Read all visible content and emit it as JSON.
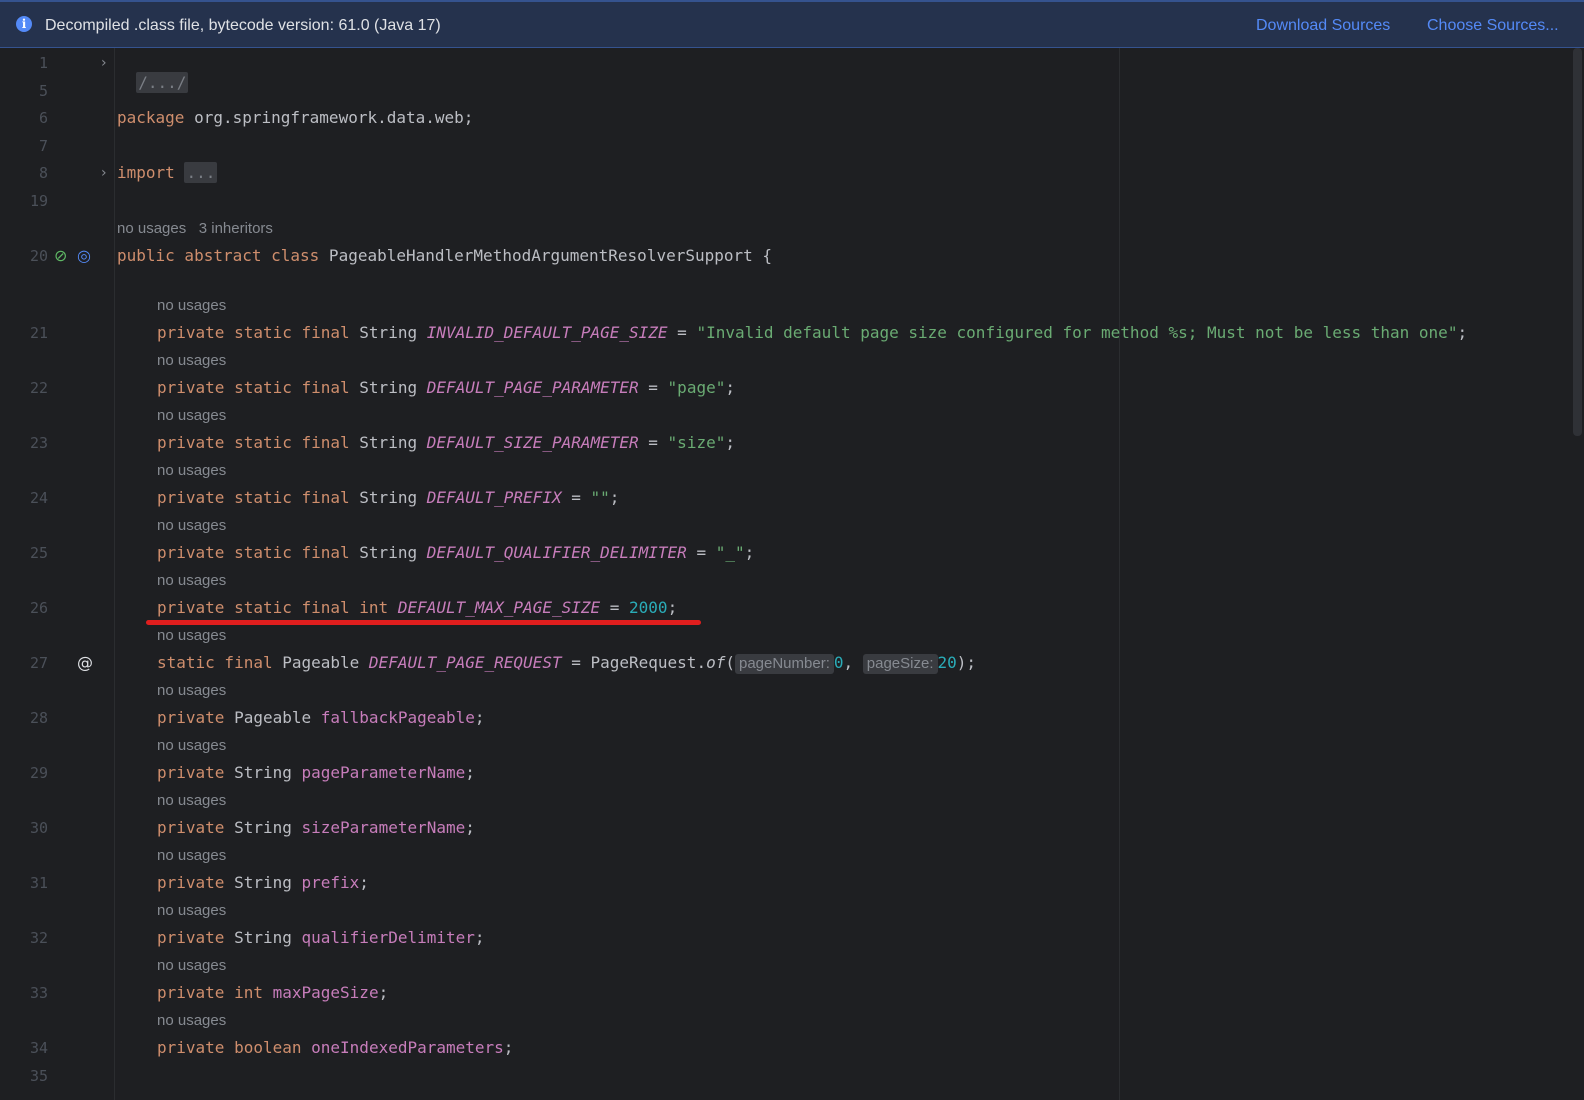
{
  "banner": {
    "icon": "info-icon",
    "message": "Decompiled .class file, bytecode version: 61.0 (Java 17)",
    "download_sources": "Download Sources",
    "choose_sources": "Choose Sources..."
  },
  "colors": {
    "keyword": "#cf8e6d",
    "constant": "#c77dbb",
    "string": "#6aab73",
    "number": "#2aacb8",
    "annotation_underline": "#e01e1e"
  },
  "lines": {
    "l1": {
      "num": "1",
      "fold": "/.../"
    },
    "l5": {
      "num": "5"
    },
    "l6": {
      "num": "6",
      "kw": "package",
      "text": " org.springframework.data.web;"
    },
    "l7": {
      "num": "7"
    },
    "l8": {
      "num": "8",
      "kw": "import",
      "fold": "..."
    },
    "l19": {
      "num": "19"
    },
    "l20": {
      "num": "20",
      "hint": "no usages   3 inheritors",
      "kw": "public abstract class",
      "text": " PageableHandlerMethodArgumentResolverSupport {"
    },
    "l21": {
      "num": "21",
      "hint": "no usages",
      "kw": "private static final",
      "type": " String ",
      "name": "INVALID_DEFAULT_PAGE_SIZE",
      "eq": " = ",
      "val": "\"Invalid default page size configured for method %s; Must not be less than one\"",
      "end": ";"
    },
    "l22": {
      "num": "22",
      "hint": "no usages",
      "kw": "private static final",
      "type": " String ",
      "name": "DEFAULT_PAGE_PARAMETER",
      "eq": " = ",
      "val": "\"page\"",
      "end": ";"
    },
    "l23": {
      "num": "23",
      "hint": "no usages",
      "kw": "private static final",
      "type": " String ",
      "name": "DEFAULT_SIZE_PARAMETER",
      "eq": " = ",
      "val": "\"size\"",
      "end": ";"
    },
    "l24": {
      "num": "24",
      "hint": "no usages",
      "kw": "private static final",
      "type": " String ",
      "name": "DEFAULT_PREFIX",
      "eq": " = ",
      "val": "\"\"",
      "end": ";"
    },
    "l25": {
      "num": "25",
      "hint": "no usages",
      "kw": "private static final",
      "type": " String ",
      "name": "DEFAULT_QUALIFIER_DELIMITER",
      "eq": " = ",
      "val": "\"_\"",
      "end": ";"
    },
    "l26": {
      "num": "26",
      "hint": "no usages",
      "kw": "private static final int",
      "name": "DEFAULT_MAX_PAGE_SIZE",
      "eq": " = ",
      "val": "2000",
      "end": ";"
    },
    "l27": {
      "num": "27",
      "hint": "no usages",
      "kw": "static final",
      "type": " Pageable ",
      "name": "DEFAULT_PAGE_REQUEST",
      "eq": " = PageRequest.",
      "method": "of",
      "open": "(",
      "p1_hint": "pageNumber:",
      "p1": "0",
      "sep": ", ",
      "p2_hint": "pageSize:",
      "p2": "20",
      "end": ");"
    },
    "l28": {
      "num": "28",
      "hint": "no usages",
      "kw": "private",
      "type": " Pageable ",
      "name": "fallbackPageable",
      "end": ";"
    },
    "l29": {
      "num": "29",
      "hint": "no usages",
      "kw": "private",
      "type": " String ",
      "name": "pageParameterName",
      "end": ";"
    },
    "l30": {
      "num": "30",
      "hint": "no usages",
      "kw": "private",
      "type": " String ",
      "name": "sizeParameterName",
      "end": ";"
    },
    "l31": {
      "num": "31",
      "hint": "no usages",
      "kw": "private",
      "type": " String ",
      "name": "prefix",
      "end": ";"
    },
    "l32": {
      "num": "32",
      "hint": "no usages",
      "kw": "private",
      "type": " String ",
      "name": "qualifierDelimiter",
      "end": ";"
    },
    "l33": {
      "num": "33",
      "hint": "no usages",
      "kw": "private int",
      "type": " ",
      "name": "maxPageSize",
      "end": ";"
    },
    "l34": {
      "num": "34",
      "hint": "no usages",
      "kw": "private boolean",
      "type": " ",
      "name": "oneIndexedParameters",
      "end": ";"
    },
    "l35": {
      "num": "35"
    }
  }
}
